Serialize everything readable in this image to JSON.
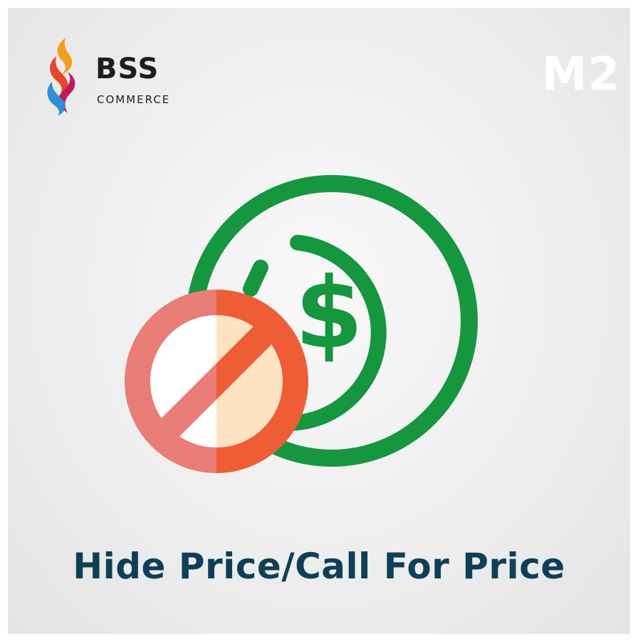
{
  "brand": {
    "logo_name": "BSS",
    "logo_sub": "COMMERCE",
    "version_badge": "M2"
  },
  "title": "Hide Price/Call For Price",
  "icons": {
    "logo_mark": "flame-logo-icon",
    "coin": "dollar-coin-icon",
    "prohibited": "prohibited-sign-icon"
  },
  "colors": {
    "coin_green": "#16963f",
    "prohibit_dark": "#ee5d36",
    "prohibit_light": "#e87e77",
    "prohibit_fill_light": "#fde3c2",
    "title_color": "#0e3f57"
  }
}
